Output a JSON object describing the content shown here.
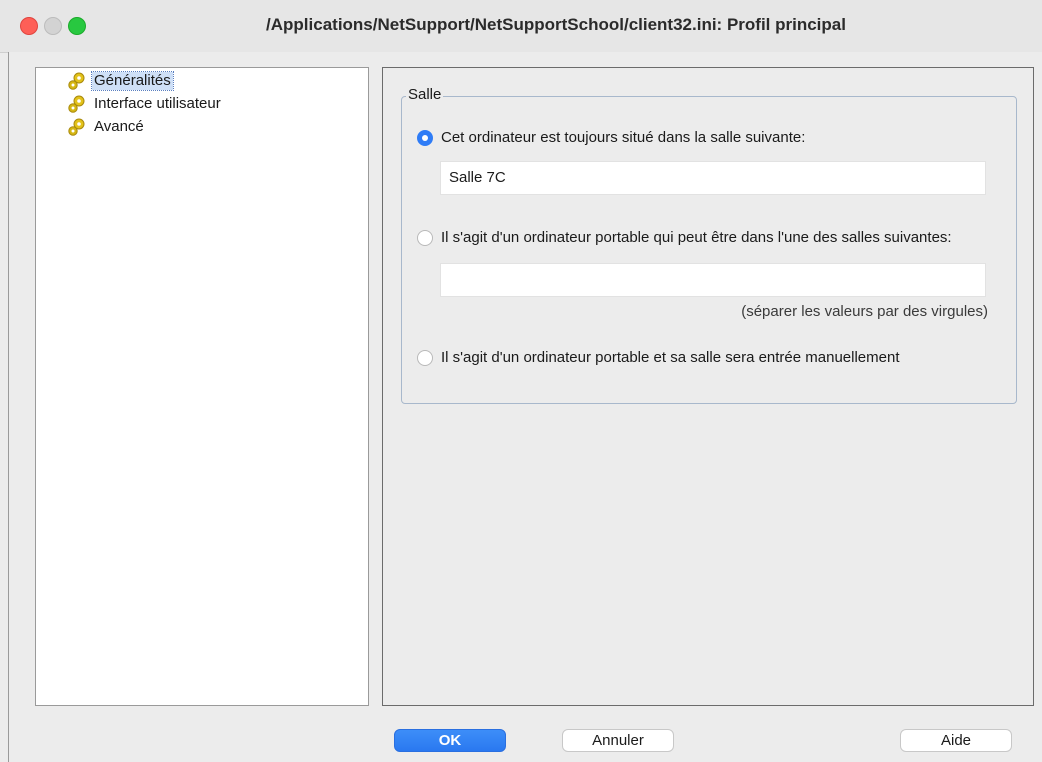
{
  "window": {
    "title": "/Applications/NetSupport/NetSupportSchool/client32.ini: Profil principal"
  },
  "tree": {
    "items": [
      {
        "label": "Généralités",
        "icon": "gear-icon",
        "selected": true
      },
      {
        "label": "Interface utilisateur",
        "icon": "gear-icon",
        "selected": false
      },
      {
        "label": "Avancé",
        "icon": "gear-icon",
        "selected": false
      }
    ]
  },
  "salle": {
    "legend": "Salle",
    "option1": {
      "label": "Cet ordinateur est toujours situé dans la salle suivante:",
      "checked": true,
      "value": "Salle 7C"
    },
    "option2": {
      "label": "Il s'agit d'un ordinateur portable qui peut être dans l'une des salles suivantes:",
      "checked": false,
      "value": "",
      "hint": "(séparer les valeurs par des virgules)"
    },
    "option3": {
      "label": "Il s'agit d'un ordinateur portable et sa salle sera entrée manuellement",
      "checked": false
    }
  },
  "buttons": {
    "ok": "OK",
    "cancel": "Annuler",
    "help": "Aide"
  },
  "colors": {
    "accent": "#2f7cf6",
    "close": "#fe5f57",
    "zoom": "#28c840"
  }
}
